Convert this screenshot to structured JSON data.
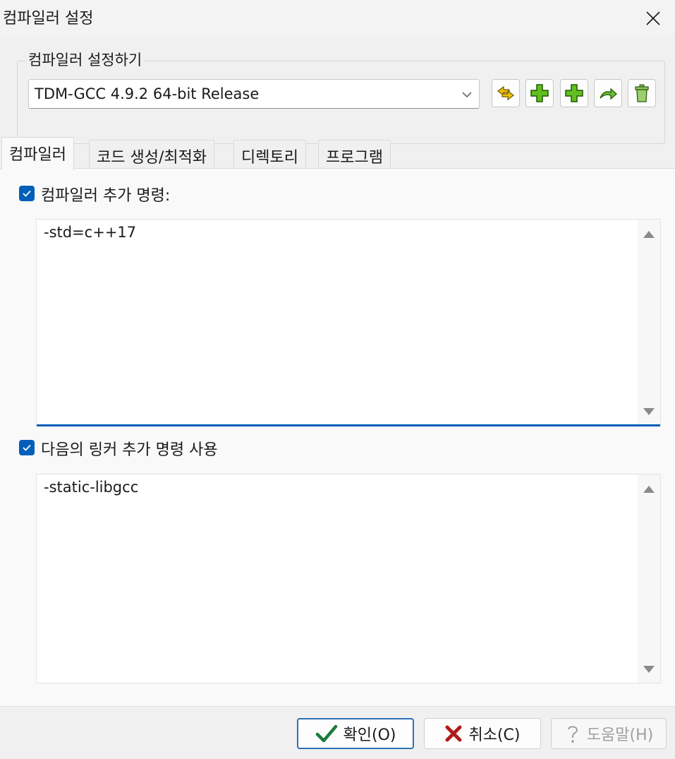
{
  "window": {
    "title": "컴파일러 설정"
  },
  "group": {
    "legend": "컴파일러 설정하기",
    "compiler_select": {
      "value": "TDM-GCC 4.9.2 64-bit Release"
    }
  },
  "toolbar_icons": [
    "find-compilers-icon",
    "add-compiler-icon",
    "add-compiler-alt-icon",
    "rename-compiler-icon",
    "delete-compiler-icon"
  ],
  "tabs": [
    {
      "label": "컴파일러",
      "active": true
    },
    {
      "label": "코드 생성/최적화",
      "active": false
    },
    {
      "label": "디렉토리",
      "active": false
    },
    {
      "label": "프로그램",
      "active": false
    }
  ],
  "compiler_options": {
    "checkbox_label": "컴파일러 추가 명령:",
    "checked": true,
    "text": "-std=c++17"
  },
  "linker_options": {
    "checkbox_label": "다음의 링커 추가 명령 사용",
    "checked": true,
    "text": "-static-libgcc"
  },
  "buttons": {
    "ok": "확인(O)",
    "cancel": "취소(C)",
    "help": "도움말(H)"
  },
  "colors": {
    "accent": "#005fb8",
    "ok_check": "#1e7a3a",
    "cancel_x": "#b01b1b"
  }
}
